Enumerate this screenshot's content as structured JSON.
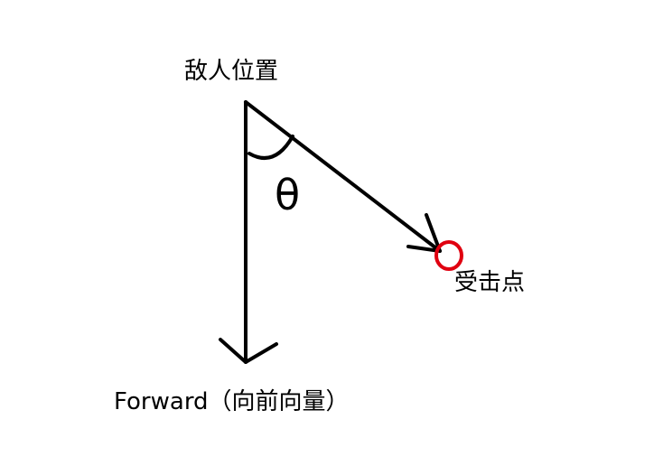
{
  "labels": {
    "enemy_position": "敌人位置",
    "hit_point": "受击点",
    "forward": "Forward（向前向量）",
    "angle": "θ"
  },
  "colors": {
    "lines": "#000000",
    "hit_marker": "#e00010",
    "background": "#ffffff"
  }
}
